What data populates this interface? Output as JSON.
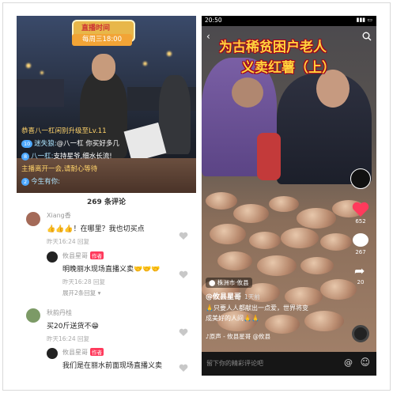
{
  "left": {
    "banner_title": "直播时间",
    "banner_time": "每周三18:00",
    "chat": [
      {
        "level": "",
        "name": "",
        "text": "恭喜八一杠闲别升级至Lv.11",
        "system": true
      },
      {
        "level": "10",
        "name": "迷失狼:",
        "text": "@八一杠 你买好多几"
      },
      {
        "level": "8",
        "name": "八一杠:",
        "text": "支持星爷,细水长流!"
      },
      {
        "level": "",
        "name": "",
        "text": "主播离开一会,请耐心等待",
        "system": true
      },
      {
        "level": "2",
        "name": "今生有你:",
        "text": ""
      }
    ],
    "comment_count": "269 条评论",
    "comments": [
      {
        "user": "Xiang香",
        "text": "👍👍👍！在哪里？我也切买点",
        "meta": "昨天16:24   回复"
      },
      {
        "user": "攸县星哥",
        "badge": "作者",
        "text": "明晚丽水现场直播义卖🤝🤝🤝",
        "meta": "昨天16:28   回复"
      },
      {
        "user": "",
        "text": "展开2条回复 ▾",
        "meta": ""
      },
      {
        "user": "秋韵丹桂",
        "text": "买20斤送货不😁",
        "meta": "昨天16:24   回复"
      },
      {
        "user": "攸县星哥",
        "badge": "作者",
        "text": "我们是在丽水前面现场直播义卖",
        "meta": ""
      }
    ]
  },
  "right": {
    "status_time": "20:50",
    "title_line1": "为古稀贫困户老人",
    "title_line2": "义卖红薯（上）",
    "side": {
      "likes": "652",
      "comments": "267",
      "shares": "20"
    },
    "location": "株洲市·攸县",
    "author_handle": "@攸县星哥",
    "age": "1天前",
    "caption_line1": "🙏只要人人都献出一点爱，世界将变",
    "caption_line2": "成美好的人间🙏🙏",
    "music": "♪原声 - 攸县星哥 @攸县",
    "comment_placeholder": "留下你的精彩评论吧"
  },
  "colors": {
    "accent": "#ff3a5c",
    "title_yellow": "#ffd23d",
    "title_outline": "#a3001a"
  }
}
